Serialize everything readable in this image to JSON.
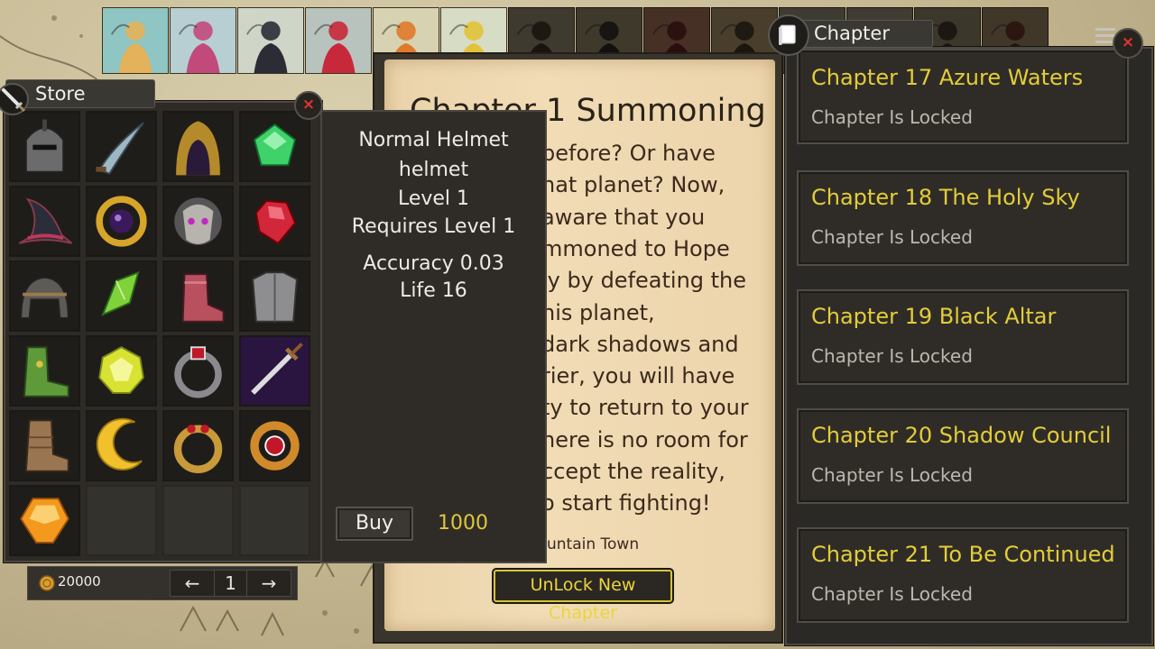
{
  "store": {
    "title": "Store",
    "close": "×",
    "items": [
      {
        "icon": "knight-helmet-icon",
        "color": "#6b6b6b"
      },
      {
        "icon": "curved-blade-icon",
        "color": "#9fb6c3"
      },
      {
        "icon": "golden-hood-icon",
        "color": "#b58a2a"
      },
      {
        "icon": "green-gem-icon",
        "color": "#3fd26a"
      },
      {
        "icon": "wizard-hat-icon",
        "color": "#2c2d3a"
      },
      {
        "icon": "purple-orb-ring-icon",
        "color": "#d6a52a"
      },
      {
        "icon": "tribal-mask-icon",
        "color": "#b7b3ad"
      },
      {
        "icon": "red-gem-icon",
        "color": "#d2263a"
      },
      {
        "icon": "iron-helmet-icon",
        "color": "#5e5a55"
      },
      {
        "icon": "green-crystal-icon",
        "color": "#7fd23a"
      },
      {
        "icon": "red-boot-icon",
        "color": "#b8505e"
      },
      {
        "icon": "steel-armor-icon",
        "color": "#8e8e90"
      },
      {
        "icon": "green-boot-icon",
        "color": "#5f9a3a"
      },
      {
        "icon": "yellow-gem-icon",
        "color": "#d8e232"
      },
      {
        "icon": "ruby-ring-icon",
        "color": "#8a8a8e"
      },
      {
        "icon": "purple-sword-icon",
        "color": "#7a3fb0"
      },
      {
        "icon": "leather-boot-icon",
        "color": "#9a7552"
      },
      {
        "icon": "crescent-moon-icon",
        "color": "#f1c12d"
      },
      {
        "icon": "gold-ring-icon",
        "color": "#c89a3a"
      },
      {
        "icon": "gold-ruby-ring-icon",
        "color": "#d18a2a"
      },
      {
        "icon": "orange-gem-icon",
        "color": "#f39a1e"
      },
      {
        "icon": "empty-slot",
        "color": ""
      },
      {
        "icon": "empty-slot",
        "color": ""
      },
      {
        "icon": "empty-slot",
        "color": ""
      }
    ],
    "coins": "20000",
    "page": "1",
    "prev": "←",
    "next": "→"
  },
  "item": {
    "name": "Normal Helmet",
    "type": "helmet",
    "level": "Level 1",
    "requires": "Requires Level 1",
    "stat1": "Accuracy 0.03",
    "stat2": "Life 16",
    "buy_label": "Buy",
    "price": "1000"
  },
  "book": {
    "heading": "Chapter 1 Summoning",
    "lines": [
      "before? Or have",
      "hat planet? Now,",
      "aware that you",
      "mmoned to Hope",
      "ly by defeating the",
      "his planet,",
      "dark shadows and",
      "rier, you will have",
      "ty to return to your",
      "here is no room for",
      "ccept the reality,",
      "o start fighting!"
    ],
    "location": "untain Town",
    "unlock_label": "UnLock New Chapter"
  },
  "chapters": {
    "title": "Chapter",
    "close": "×",
    "list": [
      {
        "title": "Chapter 17 Azure Waters",
        "status": "Chapter Is Locked"
      },
      {
        "title": "Chapter 18 The Holy Sky",
        "status": "Chapter Is Locked"
      },
      {
        "title": "Chapter 19 Black Altar",
        "status": "Chapter Is Locked"
      },
      {
        "title": "Chapter 20 Shadow Council",
        "status": "Chapter Is Locked"
      },
      {
        "title": "Chapter 21 To Be Continued",
        "status": "Chapter Is Locked"
      }
    ]
  },
  "heroes": [
    {
      "icon": "harpy-hero-portrait",
      "bg": "#8fc5c2",
      "accent": "#e3b25a",
      "locked": false
    },
    {
      "icon": "pink-mage-hero-portrait",
      "bg": "#b7cfd2",
      "accent": "#c24a7a",
      "locked": false
    },
    {
      "icon": "dark-rogue-hero-portrait",
      "bg": "#cfd6c8",
      "accent": "#2c2c36",
      "locked": false
    },
    {
      "icon": "red-knight-hero-portrait",
      "bg": "#b9c3bd",
      "accent": "#c8293a",
      "locked": false
    },
    {
      "icon": "fox-rider-hero-portrait",
      "bg": "#d7d2b2",
      "accent": "#e07a2a",
      "locked": false
    },
    {
      "icon": "golden-paladin-hero-portrait",
      "bg": "#d7dcc4",
      "accent": "#e2c23a",
      "locked": false
    },
    {
      "icon": "locked-hero-portrait-1",
      "bg": "#8a8068",
      "accent": "#3a2a20",
      "locked": true
    },
    {
      "icon": "locked-hero-portrait-2",
      "bg": "#8c7f62",
      "accent": "#2a2420",
      "locked": true
    },
    {
      "icon": "locked-hero-portrait-3",
      "bg": "#9c6a52",
      "accent": "#5a2020",
      "locked": true
    },
    {
      "icon": "locked-hero-portrait-4",
      "bg": "#a08a60",
      "accent": "#3a3020",
      "locked": true
    },
    {
      "icon": "locked-hero-portrait-5",
      "bg": "#8a8570",
      "accent": "#2a2a2a",
      "locked": true
    },
    {
      "icon": "locked-hero-portrait-6",
      "bg": "#8e8672",
      "accent": "#302a24",
      "locked": true
    },
    {
      "icon": "locked-hero-portrait-7",
      "bg": "#867b60",
      "accent": "#3a2a22",
      "locked": true
    },
    {
      "icon": "locked-hero-portrait-8",
      "bg": "#917a5c",
      "accent": "#5a2a1e",
      "locked": true
    }
  ]
}
